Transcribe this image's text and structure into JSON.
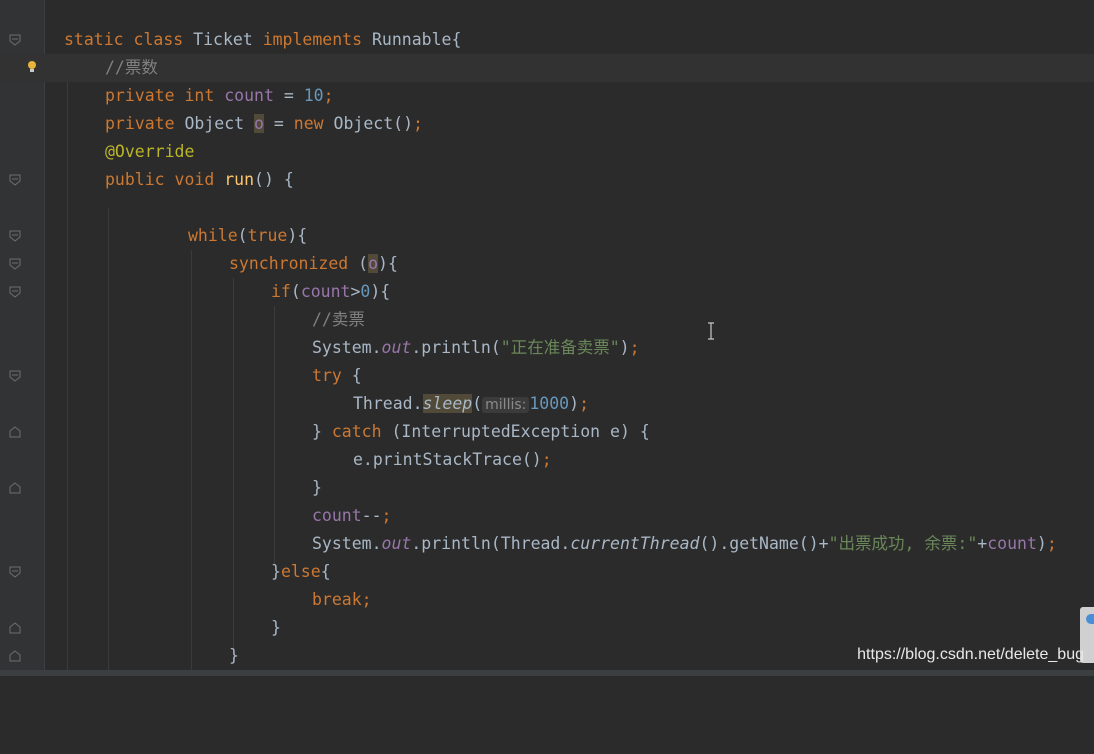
{
  "colors": {
    "background": "#2b2b2b",
    "gutter": "#313335",
    "keyword": "#cc7832",
    "comment": "#808080",
    "method": "#ffc66d",
    "field": "#9876aa",
    "number": "#6897bb",
    "string": "#6a8759",
    "annotation": "#bbb529",
    "text": "#a9b7c6"
  },
  "code": {
    "l1": {
      "kw1": "static class ",
      "name": "Ticket ",
      "kw2": "implements ",
      "iface": "Runnable{"
    },
    "l2": {
      "comment": "//票数"
    },
    "l3": {
      "kw1": "private int ",
      "field": "count",
      "eq": " = ",
      "num": "10",
      "semi": ";"
    },
    "l4": {
      "kw1": "private ",
      "type": "Object ",
      "var": "o",
      "eq": " = ",
      "kw2": "new ",
      "ctor": "Object()",
      "semi": ";"
    },
    "l5": {
      "annotation": "@Override"
    },
    "l6": {
      "kw1": "public void ",
      "method": "run",
      "rest": "() {"
    },
    "l8": {
      "kw1": "while",
      "p1": "(",
      "kw2": "true",
      "p2": "){"
    },
    "l9": {
      "kw1": "synchronized",
      "p1": " (",
      "var": "o",
      "p2": "){"
    },
    "l10": {
      "kw1": "if",
      "p1": "(",
      "field": "count",
      "op": ">",
      "num": "0",
      "p2": "){"
    },
    "l11": {
      "comment": "//卖票"
    },
    "l12": {
      "cls": "System.",
      "field": "out",
      "call": ".println(",
      "str": "\"正在准备卖票\"",
      "end": ")",
      "semi": ";"
    },
    "l13": {
      "kw1": "try",
      "rest": " {"
    },
    "l14": {
      "cls": "Thread.",
      "method": "sleep",
      "p1": "(",
      "hint": "millis:",
      "num": "1000",
      "end": ")",
      "semi": ";"
    },
    "l15": {
      "p0": "} ",
      "kw1": "catch",
      "rest": " (InterruptedException e) {"
    },
    "l16": {
      "call": "e.printStackTrace()",
      "semi": ";"
    },
    "l17": {
      "brace": "}"
    },
    "l18": {
      "field": "count",
      "op": "--",
      "semi": ";"
    },
    "l19": {
      "cls": "System.",
      "field": "out",
      "call": ".println(Thread.",
      "method": "currentThread",
      "mid": "().getName()+",
      "str": "\"出票成功, 余票:\"",
      "plus": "+",
      "field2": "count",
      "end": ")",
      "semi": ";"
    },
    "l20": {
      "p0": "}",
      "kw1": "else",
      "p1": "{"
    },
    "l21": {
      "kw1": "break",
      "semi": ";"
    },
    "l22": {
      "brace": "}"
    },
    "l23": {
      "brace": "}"
    }
  },
  "watermark": "https://blog.csdn.net/delete_bug"
}
